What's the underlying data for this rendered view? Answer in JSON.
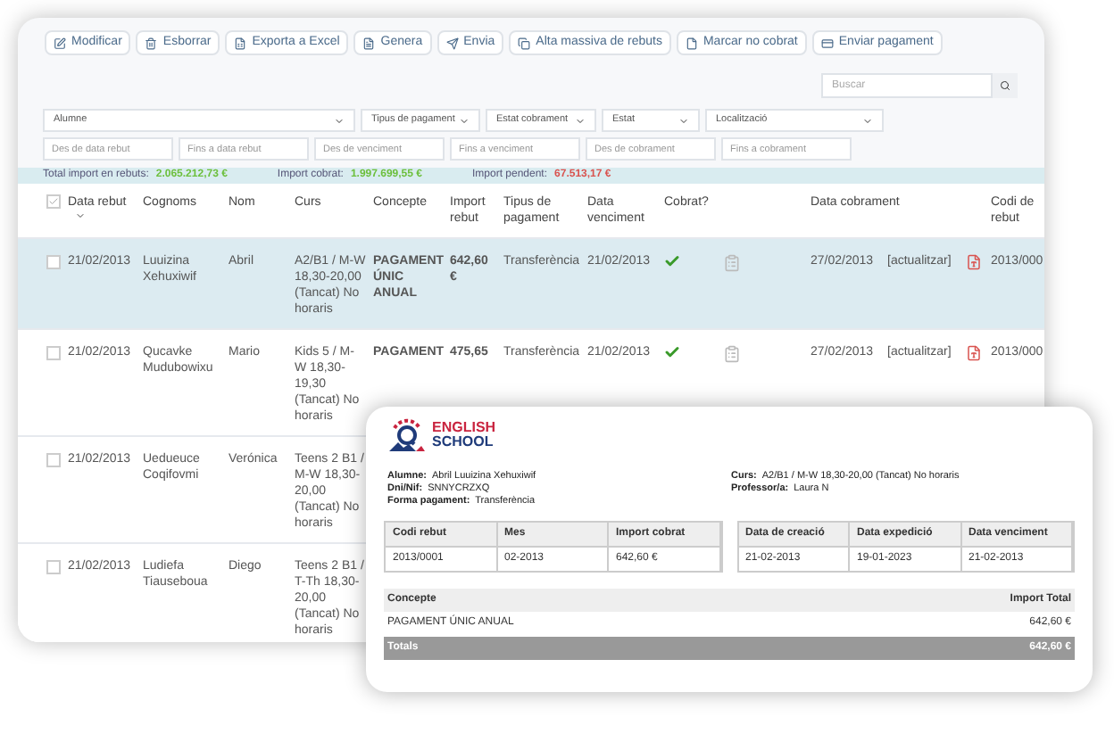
{
  "toolbar": [
    {
      "label": "Modificar"
    },
    {
      "label": "Esborrar"
    },
    {
      "label": "Exporta a Excel"
    },
    {
      "label": "Genera"
    },
    {
      "label": "Envia"
    },
    {
      "label": "Alta massiva de rebuts"
    },
    {
      "label": "Marcar no cobrat"
    },
    {
      "label": "Enviar pagament"
    }
  ],
  "search": {
    "placeholder": "Buscar"
  },
  "filters": [
    {
      "value": "Alumne"
    },
    {
      "value": "Tipus de pagament"
    },
    {
      "value": "Estat cobrament"
    },
    {
      "value": "Estat"
    },
    {
      "value": "Localització"
    }
  ],
  "date_filters": [
    {
      "placeholder": "Des de data rebut"
    },
    {
      "placeholder": "Fins a data rebut"
    },
    {
      "placeholder": "Des de venciment"
    },
    {
      "placeholder": "Fins a venciment"
    },
    {
      "placeholder": "Des de cobrament"
    },
    {
      "placeholder": "Fins a cobrament"
    }
  ],
  "totals": [
    {
      "label": "Total import en rebuts:",
      "value": "2.065.212,73 €",
      "color": "#6cbf3c"
    },
    {
      "label": "Import cobrat:",
      "value": "1.997.699,55 €",
      "color": "#6cbf3c"
    },
    {
      "label": "Import pendent:",
      "value": "67.513,17 €",
      "color": "#d9534f"
    }
  ],
  "table": {
    "columns": [
      "Data rebut",
      "Cognoms",
      "Nom",
      "Curs",
      "Concepte",
      "Import rebut",
      "Tipus de pagament",
      "Data venciment",
      "Cobrat?",
      "Data cobrament",
      "Codi de rebut"
    ],
    "rows": [
      {
        "selected": true,
        "checked": false,
        "date": "21/02/2013",
        "surname": "Luuizina Xehuxiwif",
        "name": "Abril",
        "course": "A2/B1 / M-W 18,30-20,00 (Tancat) No horaris",
        "concept": "PAGAMENT ÚNIC ANUAL",
        "amount": "642,60 €",
        "payment": "Transferència",
        "due": "21/02/2013",
        "paid": true,
        "paid_date": "27/02/2013",
        "action": "[actualitzar]",
        "code": "2013/000"
      },
      {
        "selected": false,
        "checked": false,
        "date": "21/02/2013",
        "surname": "Qucavke Mudubowixu",
        "name": "Mario",
        "course": "Kids 5 / M-W 18,30-19,30 (Tancat) No horaris",
        "concept": "PAGAMENT",
        "amount": "475,65",
        "payment": "Transferència",
        "due": "21/02/2013",
        "paid": true,
        "paid_date": "27/02/2013",
        "action": "[actualitzar]",
        "code": "2013/000"
      },
      {
        "selected": false,
        "checked": false,
        "date": "21/02/2013",
        "surname": "Uedueuce Coqifovmi",
        "name": "Verónica",
        "course": "Teens 2 B1 / M-W 18,30-20,00 (Tancat) No horaris"
      },
      {
        "selected": false,
        "checked": false,
        "date": "21/02/2013",
        "surname": "Ludiefa Tiauseboua",
        "name": "Diego",
        "course": "Teens 2 B1 / T-Th 18,30-20,00 (Tancat) No horaris"
      }
    ]
  },
  "receipt": {
    "logo": [
      "ENGLISH",
      "SCHOOL"
    ],
    "details_left": [
      {
        "label": "Alumne:",
        "value": "Abril Luuizina Xehuxiwif"
      },
      {
        "label": "Dni/Nif:",
        "value": "SNNYCRZXQ"
      },
      {
        "label": "Forma pagament:",
        "value": "Transferència"
      }
    ],
    "details_right": [
      {
        "label": "Curs:",
        "value": "A2/B1 / M-W 18,30-20,00 (Tancat) No horaris"
      },
      {
        "label": "Professor/a:",
        "value": "Laura N"
      }
    ],
    "table_left": {
      "columns": [
        "Codi rebut",
        "Mes",
        "Import cobrat"
      ],
      "row": [
        "2013/0001",
        "02-2013",
        "642,60 €"
      ]
    },
    "table_right": {
      "columns": [
        "Data de creació",
        "Data expedició",
        "Data venciment"
      ],
      "row": [
        "21-02-2013",
        "19-01-2023",
        "21-02-2013"
      ]
    },
    "lines": {
      "columns": [
        "Concepte",
        "Import Total"
      ],
      "row": [
        "PAGAMENT ÚNIC ANUAL",
        "642,60 €"
      ],
      "total": [
        "Totals",
        "642,60 €"
      ]
    }
  }
}
